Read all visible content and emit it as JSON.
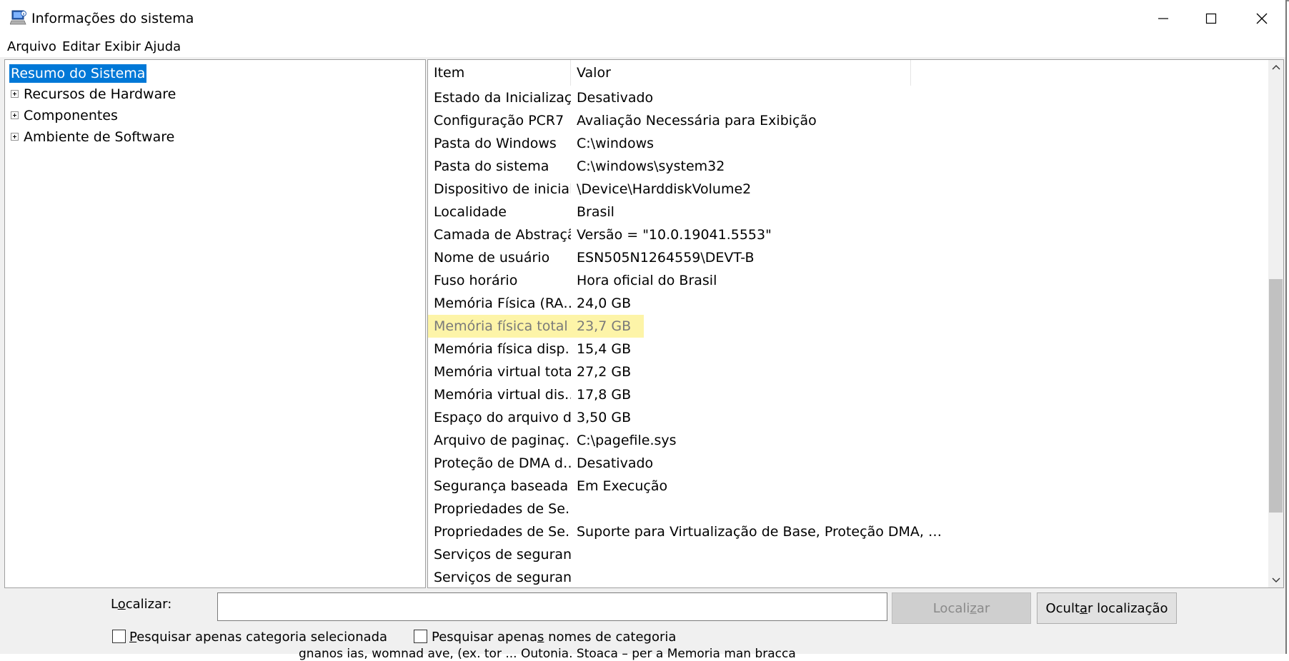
{
  "window": {
    "title": "Informações do sistema"
  },
  "menu": [
    "Arquivo",
    "Editar",
    "Exibir",
    "Ajuda"
  ],
  "tree": {
    "selected": "Resumo do Sistema",
    "items": [
      "Recursos de Hardware",
      "Componentes",
      "Ambiente de Software"
    ]
  },
  "list": {
    "headers": {
      "item": "Item",
      "value": "Valor"
    },
    "rows": [
      {
        "item": "Estado da Inicializaç…",
        "value": "Desativado"
      },
      {
        "item": "Configuração PCR7",
        "value": "Avaliação Necessária para Exibição"
      },
      {
        "item": "Pasta do Windows",
        "value": "C:\\windows"
      },
      {
        "item": "Pasta do sistema",
        "value": "C:\\windows\\system32"
      },
      {
        "item": "Dispositivo de inicial…",
        "value": "\\Device\\HarddiskVolume2"
      },
      {
        "item": "Localidade",
        "value": "Brasil"
      },
      {
        "item": "Camada de Abstraçã…",
        "value": "Versão = \"10.0.19041.5553\""
      },
      {
        "item": "Nome de usuário",
        "value": "ESN505N1264559\\DEVT-B"
      },
      {
        "item": "Fuso horário",
        "value": "Hora oficial do Brasil"
      },
      {
        "item": "Memória Física (RA…",
        "value": "24,0 GB"
      },
      {
        "item": "Memória física total",
        "value": "23,7 GB"
      },
      {
        "item": "Memória física disp…",
        "value": "15,4 GB"
      },
      {
        "item": "Memória virtual total",
        "value": "27,2 GB"
      },
      {
        "item": "Memória virtual dis…",
        "value": "17,8 GB"
      },
      {
        "item": "Espaço do arquivo d…",
        "value": "3,50 GB"
      },
      {
        "item": "Arquivo de paginaç…",
        "value": "C:\\pagefile.sys"
      },
      {
        "item": "Proteção de DMA d…",
        "value": "Desativado"
      },
      {
        "item": "Segurança baseada …",
        "value": "Em Execução"
      },
      {
        "item": "Propriedades de Se…",
        "value": ""
      },
      {
        "item": "Propriedades de Se…",
        "value": "Suporte para Virtualização de Base, Proteção DMA, …"
      },
      {
        "item": "Serviços de seguran…",
        "value": ""
      },
      {
        "item": "Serviços de seguran…",
        "value": ""
      }
    ],
    "highlighted_row": "Memória física total",
    "highlight_color": "#fdf4a8"
  },
  "find": {
    "label_pre": "L",
    "label_u": "o",
    "label_post": "calizar:",
    "input_value": "",
    "find_button": {
      "pre": "Locali",
      "u": "z",
      "post": "ar"
    },
    "hide_button": {
      "pre": "Ocult",
      "u": "a",
      "post": "r localização"
    },
    "check1": {
      "u": "P",
      "post": "esquisar apenas categoria selecionada"
    },
    "check2": {
      "pre": "Pesquisar apena",
      "u": "s",
      "post": " nomes de categoria"
    }
  },
  "background_text": "gnanos ias, womnad ave, (ex. tor ... Outonia. Stoaca – per a Memoria man bracca",
  "colors": {
    "selection": "#0078d7",
    "button_disabled": "#cfcfcf"
  }
}
